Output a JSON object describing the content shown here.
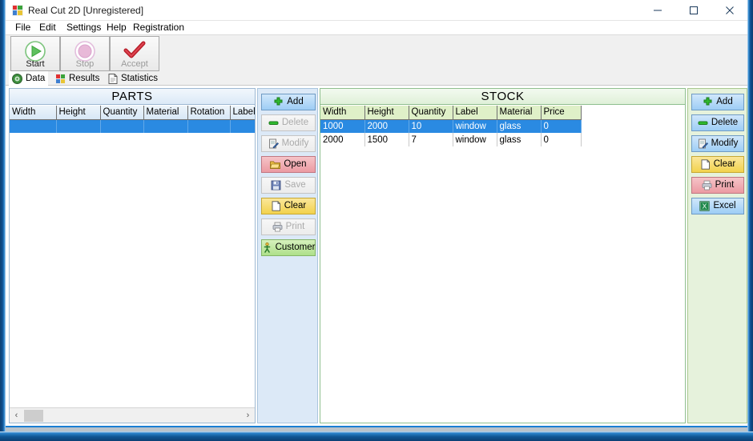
{
  "window": {
    "title": "Real Cut 2D [Unregistered]",
    "app_icon": "app-logo-icon",
    "minimize_label": "–",
    "maximize_label": "☐",
    "close_label": "✕"
  },
  "menubar": {
    "items": [
      {
        "label": "File"
      },
      {
        "label": "Edit"
      },
      {
        "label": "Settings"
      },
      {
        "label": "Help"
      },
      {
        "label": "Registration"
      }
    ]
  },
  "toolbar": {
    "buttons": [
      {
        "label": "Start",
        "icon": "play-circle-icon",
        "enabled": true
      },
      {
        "label": "Stop",
        "icon": "stop-circle-icon",
        "enabled": false
      },
      {
        "label": "Accept",
        "icon": "checkmark-icon",
        "enabled": false
      }
    ]
  },
  "tabs": [
    {
      "label": "Data",
      "icon": "disc-icon",
      "active": true
    },
    {
      "label": "Results",
      "icon": "blocks-icon",
      "active": false
    },
    {
      "label": "Statistics",
      "icon": "page-icon",
      "active": false
    }
  ],
  "parts": {
    "title": "PARTS",
    "columns": [
      "Width",
      "Height",
      "Quantity",
      "Material",
      "Rotation",
      "Label"
    ],
    "rows": [
      {
        "selected": true,
        "cells": [
          "",
          "",
          "",
          "",
          "",
          ""
        ]
      }
    ],
    "scrollbar": {
      "left_arrow": "‹",
      "right_arrow": "›"
    }
  },
  "stock": {
    "title": "STOCK",
    "columns": [
      "Width",
      "Height",
      "Quantity",
      "Label",
      "Material",
      "Price"
    ],
    "rows": [
      {
        "selected": true,
        "cells": [
          "1000",
          "2000",
          "10",
          "window",
          "glass",
          "0"
        ]
      },
      {
        "selected": false,
        "cells": [
          "2000",
          "1500",
          "7",
          "window",
          "glass",
          "0"
        ]
      }
    ]
  },
  "parts_buttons": [
    {
      "label": "Add",
      "icon": "plus-icon",
      "style": "blue",
      "enabled": true
    },
    {
      "label": "Delete",
      "icon": "minus-icon",
      "style": "gray",
      "enabled": false
    },
    {
      "label": "Modify",
      "icon": "edit-icon",
      "style": "gray",
      "enabled": false
    },
    {
      "label": "Open",
      "icon": "folder-icon",
      "style": "red",
      "enabled": true
    },
    {
      "label": "Save",
      "icon": "floppy-icon",
      "style": "gray",
      "enabled": false
    },
    {
      "label": "Clear",
      "icon": "page-icon",
      "style": "yellow",
      "enabled": true
    },
    {
      "label": "Print",
      "icon": "printer-icon",
      "style": "gray",
      "enabled": false
    },
    {
      "label": "Customer",
      "icon": "person-icon",
      "style": "green",
      "enabled": true
    }
  ],
  "stock_buttons": [
    {
      "label": "Add",
      "icon": "plus-icon",
      "style": "blue",
      "enabled": true
    },
    {
      "label": "Delete",
      "icon": "minus-icon",
      "style": "blue",
      "enabled": true
    },
    {
      "label": "Modify",
      "icon": "edit-icon",
      "style": "blue",
      "enabled": true
    },
    {
      "label": "Clear",
      "icon": "page-icon",
      "style": "yellow",
      "enabled": true
    },
    {
      "label": "Print",
      "icon": "printer-icon",
      "style": "red",
      "enabled": true
    },
    {
      "label": "Excel",
      "icon": "excel-icon",
      "style": "blue",
      "enabled": true
    }
  ],
  "colors": {
    "selection_blue": "#2a8ae2",
    "parts_panel_bg": "#dce9f7",
    "stock_panel_bg": "#e6f2dc",
    "window_border": "#0c4a82"
  }
}
